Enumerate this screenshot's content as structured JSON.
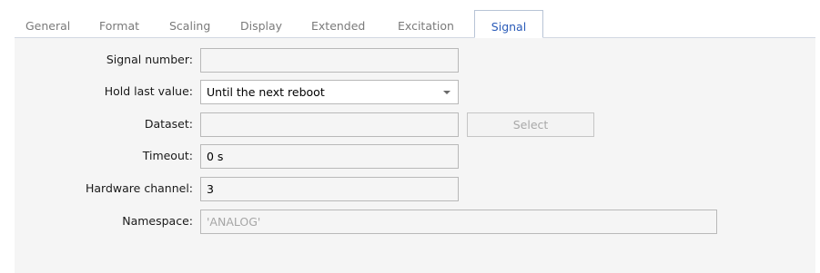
{
  "tabs": [
    {
      "label": "General",
      "active": false
    },
    {
      "label": "Format",
      "active": false
    },
    {
      "label": "Scaling",
      "active": false
    },
    {
      "label": "Display",
      "active": false
    },
    {
      "label": "Extended",
      "active": false
    },
    {
      "label": "Excitation",
      "active": false
    },
    {
      "label": "Signal",
      "active": true
    }
  ],
  "form": {
    "signal_number": {
      "label": "Signal number:",
      "value": ""
    },
    "hold_last_value": {
      "label": "Hold last value:",
      "value": "Until the next reboot"
    },
    "dataset": {
      "label": "Dataset:",
      "value": "",
      "select_label": "Select"
    },
    "timeout": {
      "label": "Timeout:",
      "value": "0 s"
    },
    "hardware_channel": {
      "label": "Hardware channel:",
      "value": "3"
    },
    "namespace": {
      "label": "Namespace:",
      "value": "'ANALOG'"
    }
  },
  "colors": {
    "active_tab_text": "#2a5bb8",
    "inactive_tab_text": "#7a7a7a",
    "panel_background": "#f5f5f5",
    "disabled_text": "#a6a6a6"
  },
  "icons": {
    "dropdown": "chevron-down-icon"
  }
}
